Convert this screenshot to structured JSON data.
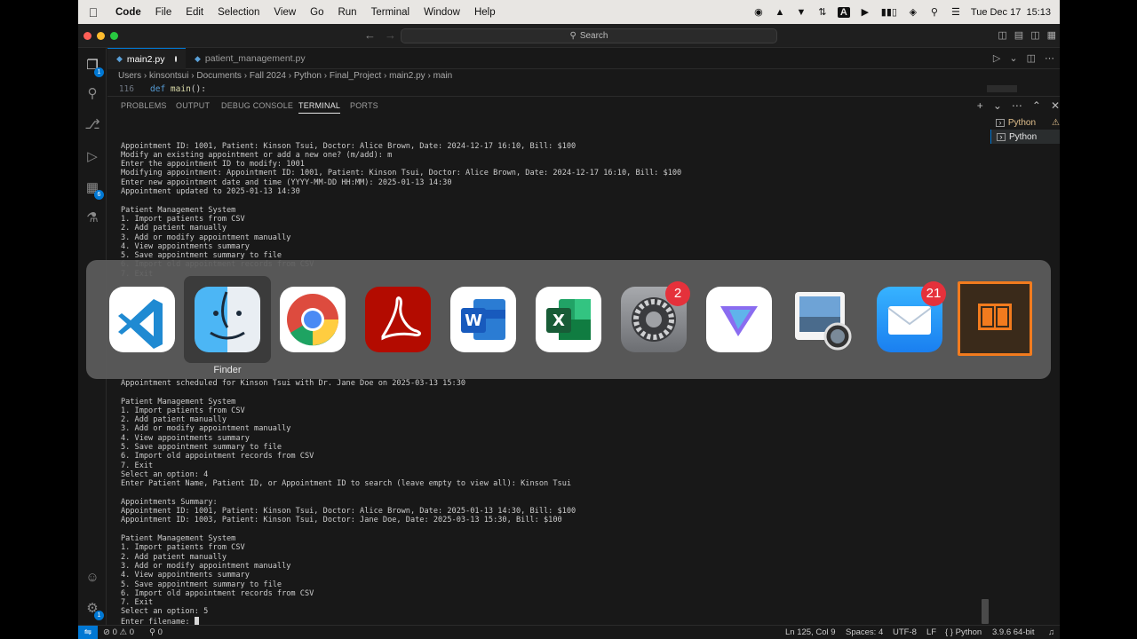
{
  "menubar": {
    "app": "Code",
    "items": [
      "File",
      "Edit",
      "Selection",
      "View",
      "Go",
      "Run",
      "Terminal",
      "Window",
      "Help"
    ],
    "datetime": "Tue Dec 17  15:13"
  },
  "titlebar": {
    "search": "Search"
  },
  "tabs": [
    {
      "label": "main2.py",
      "modified": true,
      "active": true
    },
    {
      "label": "patient_management.py",
      "modified": false,
      "active": false
    }
  ],
  "breadcrumb": "Users  ›  kinsontsui  ›  Documents  ›  Fall 2024  ›  Python  ›  Final_Project  ›  main2.py  ›  main",
  "editor_line": {
    "number": "116",
    "keyword": "def",
    "func": "main",
    "rest": "():"
  },
  "activity_badges": {
    "source_control": "1",
    "extensions": "6"
  },
  "panel": {
    "tabs": [
      "PROBLEMS",
      "OUTPUT",
      "DEBUG CONSOLE",
      "TERMINAL",
      "PORTS"
    ],
    "active": "TERMINAL",
    "terminals": [
      "Python",
      "Python"
    ]
  },
  "terminal_top": "Appointment ID: 1001, Patient: Kinson Tsui, Doctor: Alice Brown, Date: 2024-12-17 16:10, Bill: $100\nModify an existing appointment or add a new one? (m/add): m\nEnter the appointment ID to modify: 1001\nModifying appointment: Appointment ID: 1001, Patient: Kinson Tsui, Doctor: Alice Brown, Date: 2024-12-17 16:10, Bill: $100\nEnter new appointment date and time (YYYY-MM-DD HH:MM): 2025-01-13 14:30\nAppointment updated to 2025-01-13 14:30\n\nPatient Management System\n1. Import patients from CSV\n2. Add patient manually\n3. Add or modify appointment manually\n4. View appointments summary\n5. Save appointment summary to file\n6. Import old appointment records from CSV\n7. Exit",
  "terminal_bottom": "Appointment scheduled for Kinson Tsui with Dr. Jane Doe on 2025-03-13 15:30\n\nPatient Management System\n1. Import patients from CSV\n2. Add patient manually\n3. Add or modify appointment manually\n4. View appointments summary\n5. Save appointment summary to file\n6. Import old appointment records from CSV\n7. Exit\nSelect an option: 4\nEnter Patient Name, Patient ID, or Appointment ID to search (leave empty to view all): Kinson Tsui\n\nAppointments Summary:\nAppointment ID: 1001, Patient: Kinson Tsui, Doctor: Alice Brown, Date: 2025-01-13 14:30, Bill: $100\nAppointment ID: 1003, Patient: Kinson Tsui, Doctor: Jane Doe, Date: 2025-03-13 15:30, Bill: $100\n\nPatient Management System\n1. Import patients from CSV\n2. Add patient manually\n3. Add or modify appointment manually\n4. View appointments summary\n5. Save appointment summary to file\n6. Import old appointment records from CSV\n7. Exit\nSelect an option: 5\nEnter filename: ",
  "statusbar": {
    "errors": "0",
    "warnings": "0",
    "ports": "0",
    "position": "Ln 125, Col 9",
    "spaces": "Spaces: 4",
    "encoding": "UTF-8",
    "eol": "LF",
    "language": "Python",
    "interpreter": "3.9.6 64-bit"
  },
  "app_switcher": {
    "selected_label": "Finder",
    "apps": [
      {
        "name": "vscode-icon"
      },
      {
        "name": "finder-icon"
      },
      {
        "name": "chrome-icon"
      },
      {
        "name": "acrobat-icon"
      },
      {
        "name": "word-icon"
      },
      {
        "name": "excel-icon"
      },
      {
        "name": "system-settings-icon",
        "badge": "2"
      },
      {
        "name": "protonvpn-icon"
      },
      {
        "name": "preview-icon"
      },
      {
        "name": "mail-icon",
        "badge": "21"
      },
      {
        "name": "books-icon"
      }
    ]
  },
  "colors": {
    "accent": "#0078d4",
    "badge": "#e5313b",
    "background": "#181818"
  }
}
